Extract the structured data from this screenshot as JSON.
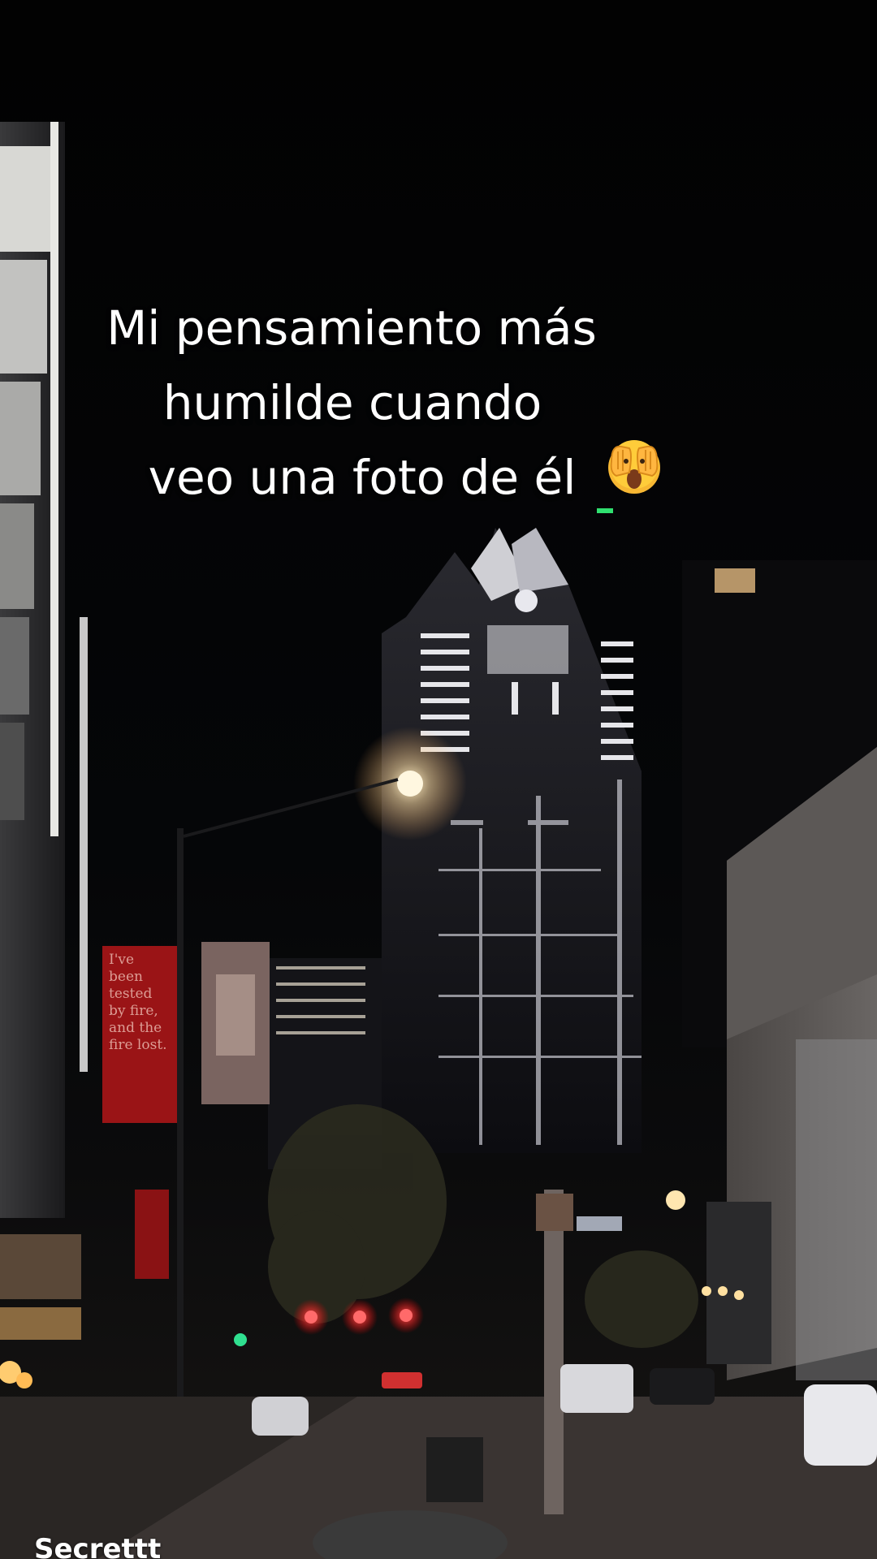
{
  "caption": {
    "line1": "Mi pensamiento más",
    "line2": "humilde cuando",
    "line3": "veo una foto de él"
  },
  "emoji": "face-with-hands-over-eyes-icon",
  "banner": {
    "text": "I've been tested by fire, and the fire lost."
  },
  "watermark": "Secrettt"
}
